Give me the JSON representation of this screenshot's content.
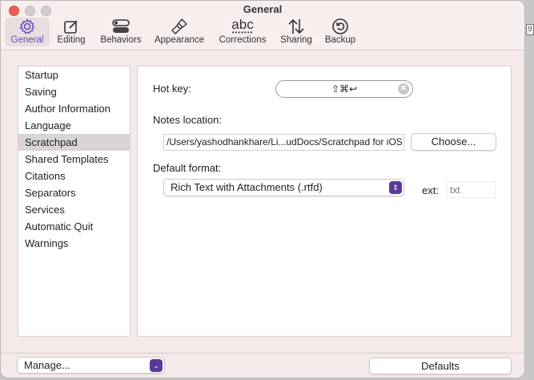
{
  "window": {
    "title": "General"
  },
  "toolbar": [
    {
      "label": "General",
      "icon": "gear-icon",
      "selected": true
    },
    {
      "label": "Editing",
      "icon": "edit-icon"
    },
    {
      "label": "Behaviors",
      "icon": "toggles-icon"
    },
    {
      "label": "Appearance",
      "icon": "paintbrush-icon"
    },
    {
      "label": "Corrections",
      "icon": "abc-icon",
      "icon_text": "abc"
    },
    {
      "label": "Sharing",
      "icon": "arrows-up-down-icon"
    },
    {
      "label": "Backup",
      "icon": "backup-icon"
    }
  ],
  "sidebar": {
    "items": [
      "Startup",
      "Saving",
      "Author Information",
      "Language",
      "Scratchpad",
      "Shared Templates",
      "Citations",
      "Separators",
      "Services",
      "Automatic Quit",
      "Warnings"
    ],
    "selected": "Scratchpad"
  },
  "panel": {
    "hotkey_label": "Hot key:",
    "hotkey_value": "⇧⌘↩",
    "notes_label": "Notes location:",
    "notes_path": "/Users/yashodhankhare/Li...udDocs/Scratchpad for iOS",
    "choose_label": "Choose...",
    "format_label": "Default format:",
    "format_value": "Rich Text with Attachments (.rtfd)",
    "ext_label": "ext:",
    "ext_placeholder": "txt"
  },
  "footer": {
    "manage_label": "Manage...",
    "defaults_label": "Defaults"
  },
  "desktop": {
    "badge": "9"
  },
  "colors": {
    "accent": "#6b44c2",
    "close": "#ec5f57"
  }
}
